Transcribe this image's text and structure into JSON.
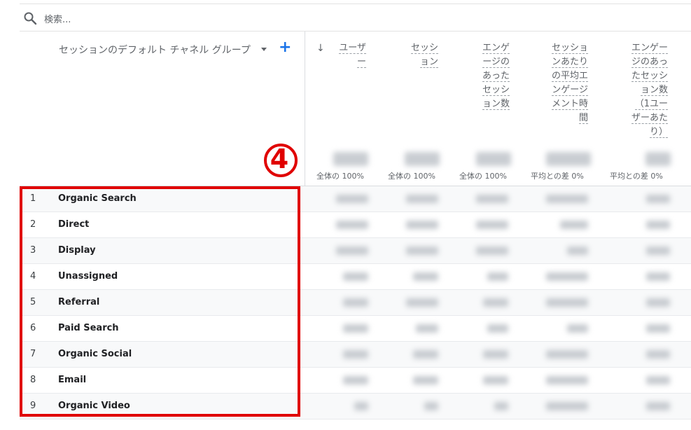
{
  "search": {
    "placeholder": "検索..."
  },
  "table": {
    "dimension_header": "セッションのデフォルト チャネル グループ",
    "add_label": "+",
    "metric_headers": [
      {
        "lines": [
          "ユーザ",
          "ー"
        ]
      },
      {
        "lines": [
          "セッシ",
          "ョン"
        ]
      },
      {
        "lines": [
          "エンゲ",
          "ージの",
          "あった",
          "セッシ",
          "ョン数"
        ]
      },
      {
        "lines": [
          "セッショ",
          "ンあたり",
          "の平均エ",
          "ンゲージ",
          "メント時",
          "間"
        ]
      },
      {
        "lines": [
          "エンゲー",
          "ジのあっ",
          "たセッシ",
          "ョン数",
          "（1ユー",
          "ザーあた",
          "り）"
        ]
      }
    ],
    "totals_sublabels": [
      "全体の 100%",
      "全体の 100%",
      "全体の 100%",
      "平均との差 0%",
      "平均との差 0%"
    ],
    "rows": [
      {
        "num": "1",
        "label": "Organic Search"
      },
      {
        "num": "2",
        "label": "Direct"
      },
      {
        "num": "3",
        "label": "Display"
      },
      {
        "num": "4",
        "label": "Unassigned"
      },
      {
        "num": "5",
        "label": "Referral"
      },
      {
        "num": "6",
        "label": "Paid Search"
      },
      {
        "num": "7",
        "label": "Organic Social"
      },
      {
        "num": "8",
        "label": "Email"
      },
      {
        "num": "9",
        "label": "Organic Video"
      }
    ]
  },
  "annotation": {
    "label": "4",
    "color": "#e00000"
  }
}
